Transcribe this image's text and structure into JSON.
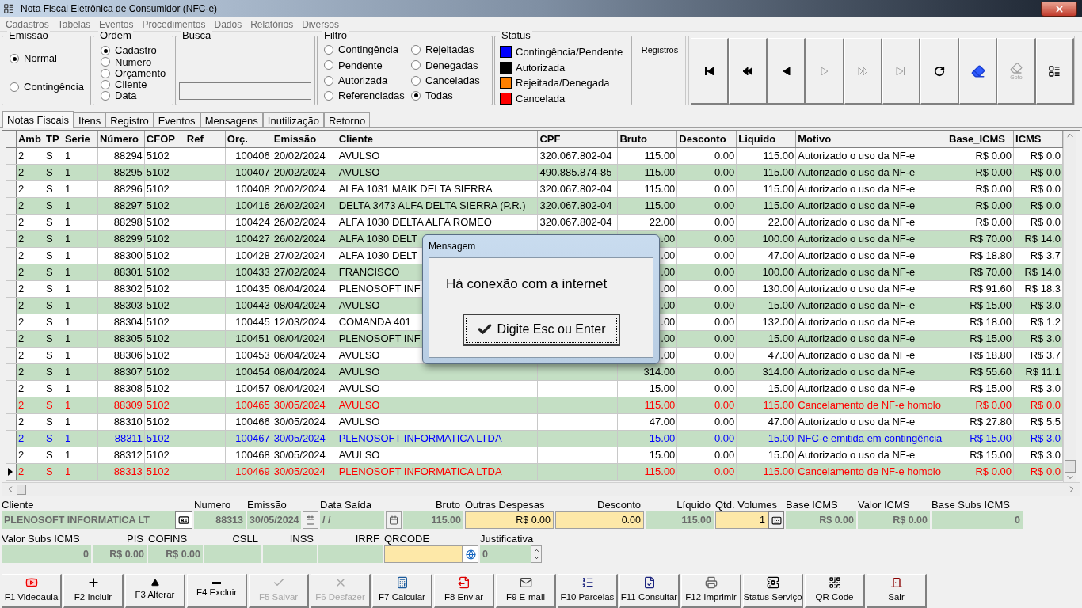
{
  "window": {
    "title": "Nota Fiscal Eletrônica de Consumidor (NFC-e)"
  },
  "menu": [
    "Cadastros",
    "Tabelas",
    "Eventos",
    "Procedimentos",
    "Dados",
    "Relatórios",
    "Diversos"
  ],
  "emissao": {
    "title": "Emissão",
    "options": [
      {
        "label": "Normal",
        "selected": true
      },
      {
        "label": "Contingência",
        "selected": false
      }
    ]
  },
  "ordem": {
    "title": "Ordem",
    "options": [
      {
        "label": "Cadastro",
        "selected": true
      },
      {
        "label": "Numero",
        "selected": false
      },
      {
        "label": "Orçamento",
        "selected": false
      },
      {
        "label": "Cliente",
        "selected": false
      },
      {
        "label": "Data",
        "selected": false
      }
    ]
  },
  "busca": {
    "title": "Busca"
  },
  "filtro": {
    "title": "Filtro",
    "options": [
      {
        "label": "Contingência",
        "selected": false
      },
      {
        "label": "Rejeitadas",
        "selected": false
      },
      {
        "label": "Pendente",
        "selected": false
      },
      {
        "label": "Denegadas",
        "selected": false
      },
      {
        "label": "Autorizada",
        "selected": false
      },
      {
        "label": "Canceladas",
        "selected": false
      },
      {
        "label": "Referenciadas",
        "selected": false
      },
      {
        "label": "Todas",
        "selected": true
      }
    ]
  },
  "status": {
    "title": "Status",
    "items": [
      {
        "label": "Contingência/Pendente",
        "color": "#0000ff"
      },
      {
        "label": "Autorizada",
        "color": "#000000"
      },
      {
        "label": "Rejeitada/Denegada",
        "color": "#ff8000"
      },
      {
        "label": "Cancelada",
        "color": "#ff0000"
      }
    ]
  },
  "registros": {
    "title": "Registros"
  },
  "nav_buttons": [
    {
      "kind": "first",
      "disabled": false
    },
    {
      "kind": "prior-page",
      "disabled": false
    },
    {
      "kind": "prior",
      "disabled": false
    },
    {
      "kind": "next",
      "disabled": true
    },
    {
      "kind": "next-page",
      "disabled": true
    },
    {
      "kind": "last",
      "disabled": true
    },
    {
      "kind": "refresh",
      "disabled": false
    },
    {
      "kind": "edit",
      "disabled": false
    },
    {
      "kind": "goto",
      "label": "Goto",
      "disabled": true
    },
    {
      "kind": "form",
      "disabled": false
    }
  ],
  "tabs": [
    {
      "label": "Notas Fiscais",
      "selected": true
    },
    {
      "label": "Itens",
      "selected": false
    },
    {
      "label": "Registro",
      "selected": false
    },
    {
      "label": "Eventos",
      "selected": false
    },
    {
      "label": "Mensagens",
      "selected": false
    },
    {
      "label": "Inutilização",
      "selected": false
    },
    {
      "label": "Retorno",
      "selected": false
    }
  ],
  "table": {
    "columns": [
      "Amb",
      "TP",
      "Serie",
      "Número",
      "CFOP",
      "Ref",
      "Orç.",
      "Emissão",
      "Cliente",
      "CPF",
      "Bruto",
      "Desconto",
      "Liquido",
      "Motivo",
      "Base_ICMS",
      "ICMS"
    ],
    "rows": [
      {
        "kind": "autorizada",
        "selected": false,
        "amb": "2",
        "tp": "S",
        "serie": "1",
        "numero": "88294",
        "cfop": "5102",
        "orc": "100406",
        "emissao": "20/02/2024",
        "cliente": "AVULSO",
        "cpf": "320.067.802-04",
        "bruto": "115.00",
        "desconto": "0.00",
        "liquido": "115.00",
        "motivo": "Autorizado o uso da NF-e",
        "base_icms": "R$ 0.00",
        "icms": "R$ 0.0"
      },
      {
        "kind": "autorizada",
        "selected": false,
        "amb": "2",
        "tp": "S",
        "serie": "1",
        "numero": "88295",
        "cfop": "5102",
        "orc": "100407",
        "emissao": "20/02/2024",
        "cliente": "AVULSO",
        "cpf": "490.885.874-85",
        "bruto": "115.00",
        "desconto": "0.00",
        "liquido": "115.00",
        "motivo": "Autorizado o uso da NF-e",
        "base_icms": "R$ 0.00",
        "icms": "R$ 0.0"
      },
      {
        "kind": "autorizada",
        "selected": false,
        "amb": "2",
        "tp": "S",
        "serie": "1",
        "numero": "88296",
        "cfop": "5102",
        "orc": "100408",
        "emissao": "20/02/2024",
        "cliente": "ALFA 1031 MAIK DELTA SIERRA",
        "cpf": "320.067.802-04",
        "bruto": "115.00",
        "desconto": "0.00",
        "liquido": "115.00",
        "motivo": "Autorizado o uso da NF-e",
        "base_icms": "R$ 0.00",
        "icms": "R$ 0.0"
      },
      {
        "kind": "autorizada",
        "selected": false,
        "amb": "2",
        "tp": "S",
        "serie": "1",
        "numero": "88297",
        "cfop": "5102",
        "orc": "100416",
        "emissao": "26/02/2024",
        "cliente": "DELTA 3473 ALFA DELTA SIERRA (P.R.)",
        "cpf": "320.067.802-04",
        "bruto": "115.00",
        "desconto": "0.00",
        "liquido": "115.00",
        "motivo": "Autorizado o uso da NF-e",
        "base_icms": "R$ 0.00",
        "icms": "R$ 0.0"
      },
      {
        "kind": "autorizada",
        "selected": false,
        "amb": "2",
        "tp": "S",
        "serie": "1",
        "numero": "88298",
        "cfop": "5102",
        "orc": "100424",
        "emissao": "26/02/2024",
        "cliente": "ALFA 1030 DELTA ALFA ROMEO",
        "cpf": "320.067.802-04",
        "bruto": "22.00",
        "desconto": "0.00",
        "liquido": "22.00",
        "motivo": "Autorizado o uso da NF-e",
        "base_icms": "R$ 0.00",
        "icms": "R$ 0.0"
      },
      {
        "kind": "autorizada",
        "selected": false,
        "amb": "2",
        "tp": "S",
        "serie": "1",
        "numero": "88299",
        "cfop": "5102",
        "orc": "100427",
        "emissao": "26/02/2024",
        "cliente": "ALFA 1030 DELT",
        "bruto": ".00",
        "desconto": "0.00",
        "liquido": "100.00",
        "motivo": "Autorizado o uso da NF-e",
        "base_icms": "R$ 70.00",
        "icms": "R$ 14.0"
      },
      {
        "kind": "autorizada",
        "selected": false,
        "amb": "2",
        "tp": "S",
        "serie": "1",
        "numero": "88300",
        "cfop": "5102",
        "orc": "100428",
        "emissao": "27/02/2024",
        "cliente": "ALFA 1030 DELT",
        "bruto": ".00",
        "desconto": "0.00",
        "liquido": "47.00",
        "motivo": "Autorizado o uso da NF-e",
        "base_icms": "R$ 18.80",
        "icms": "R$ 3.7"
      },
      {
        "kind": "autorizada",
        "selected": false,
        "amb": "2",
        "tp": "S",
        "serie": "1",
        "numero": "88301",
        "cfop": "5102",
        "orc": "100433",
        "emissao": "27/02/2024",
        "cliente": "FRANCISCO",
        "bruto": ".00",
        "desconto": "0.00",
        "liquido": "100.00",
        "motivo": "Autorizado o uso da NF-e",
        "base_icms": "R$ 70.00",
        "icms": "R$ 14.0"
      },
      {
        "kind": "autorizada",
        "selected": false,
        "amb": "2",
        "tp": "S",
        "serie": "1",
        "numero": "88302",
        "cfop": "5102",
        "orc": "100435",
        "emissao": "08/04/2024",
        "cliente": "PLENOSOFT INF",
        "bruto": ".00",
        "desconto": "0.00",
        "liquido": "130.00",
        "motivo": "Autorizado o uso da NF-e",
        "base_icms": "R$ 91.60",
        "icms": "R$ 18.3"
      },
      {
        "kind": "autorizada",
        "selected": false,
        "amb": "2",
        "tp": "S",
        "serie": "1",
        "numero": "88303",
        "cfop": "5102",
        "orc": "100443",
        "emissao": "08/04/2024",
        "cliente": "AVULSO",
        "bruto": ".00",
        "desconto": "0.00",
        "liquido": "15.00",
        "motivo": "Autorizado o uso da NF-e",
        "base_icms": "R$ 15.00",
        "icms": "R$ 3.0"
      },
      {
        "kind": "autorizada",
        "selected": false,
        "amb": "2",
        "tp": "S",
        "serie": "1",
        "numero": "88304",
        "cfop": "5102",
        "orc": "100445",
        "emissao": "12/03/2024",
        "cliente": "COMANDA 401",
        "bruto": ".00",
        "desconto": "0.00",
        "liquido": "132.00",
        "motivo": "Autorizado o uso da NF-e",
        "base_icms": "R$ 18.00",
        "icms": "R$ 1.2"
      },
      {
        "kind": "autorizada",
        "selected": false,
        "amb": "2",
        "tp": "S",
        "serie": "1",
        "numero": "88305",
        "cfop": "5102",
        "orc": "100451",
        "emissao": "08/04/2024",
        "cliente": "PLENOSOFT INF",
        "bruto": ".00",
        "desconto": "0.00",
        "liquido": "15.00",
        "motivo": "Autorizado o uso da NF-e",
        "base_icms": "R$ 15.00",
        "icms": "R$ 3.0"
      },
      {
        "kind": "autorizada",
        "selected": false,
        "amb": "2",
        "tp": "S",
        "serie": "1",
        "numero": "88306",
        "cfop": "5102",
        "orc": "100453",
        "emissao": "06/04/2024",
        "cliente": "AVULSO",
        "bruto": ".00",
        "desconto": "0.00",
        "liquido": "47.00",
        "motivo": "Autorizado o uso da NF-e",
        "base_icms": "R$ 18.80",
        "icms": "R$ 3.7"
      },
      {
        "kind": "autorizada",
        "selected": false,
        "amb": "2",
        "tp": "S",
        "serie": "1",
        "numero": "88307",
        "cfop": "5102",
        "orc": "100454",
        "emissao": "08/04/2024",
        "cliente": "AVULSO",
        "bruto": "314.00",
        "desconto": "0.00",
        "liquido": "314.00",
        "motivo": "Autorizado o uso da NF-e",
        "base_icms": "R$ 55.60",
        "icms": "R$ 11.1"
      },
      {
        "kind": "autorizada",
        "selected": false,
        "amb": "2",
        "tp": "S",
        "serie": "1",
        "numero": "88308",
        "cfop": "5102",
        "orc": "100457",
        "emissao": "08/04/2024",
        "cliente": "AVULSO",
        "bruto": "15.00",
        "desconto": "0.00",
        "liquido": "15.00",
        "motivo": "Autorizado o uso da NF-e",
        "base_icms": "R$ 15.00",
        "icms": "R$ 3.0"
      },
      {
        "kind": "cancelada",
        "selected": false,
        "amb": "2",
        "tp": "S",
        "serie": "1",
        "numero": "88309",
        "cfop": "5102",
        "orc": "100465",
        "emissao": "30/05/2024",
        "cliente": "AVULSO",
        "bruto": "115.00",
        "desconto": "0.00",
        "liquido": "115.00",
        "motivo": "Cancelamento de NF-e homolo",
        "base_icms": "R$ 0.00",
        "icms": "R$ 0.0"
      },
      {
        "kind": "autorizada",
        "selected": false,
        "amb": "2",
        "tp": "S",
        "serie": "1",
        "numero": "88310",
        "cfop": "5102",
        "orc": "100466",
        "emissao": "30/05/2024",
        "cliente": "AVULSO",
        "bruto": "47.00",
        "desconto": "0.00",
        "liquido": "47.00",
        "motivo": "Autorizado o uso da NF-e",
        "base_icms": "R$ 27.80",
        "icms": "R$ 5.5"
      },
      {
        "kind": "contingencia",
        "selected": false,
        "amb": "2",
        "tp": "S",
        "serie": "1",
        "numero": "88311",
        "cfop": "5102",
        "orc": "100467",
        "emissao": "30/05/2024",
        "cliente": "PLENOSOFT INFORMATICA LTDA",
        "bruto": "15.00",
        "desconto": "0.00",
        "liquido": "15.00",
        "motivo": "NFC-e emitida em contingência",
        "base_icms": "R$ 15.00",
        "icms": "R$ 3.0"
      },
      {
        "kind": "autorizada",
        "selected": false,
        "amb": "2",
        "tp": "S",
        "serie": "1",
        "numero": "88312",
        "cfop": "5102",
        "orc": "100468",
        "emissao": "30/05/2024",
        "cliente": "AVULSO",
        "bruto": "15.00",
        "desconto": "0.00",
        "liquido": "15.00",
        "motivo": "Autorizado o uso da NF-e",
        "base_icms": "R$ 15.00",
        "icms": "R$ 3.0"
      },
      {
        "kind": "cancelada",
        "selected": true,
        "amb": "2",
        "tp": "S",
        "serie": "1",
        "numero": "88313",
        "cfop": "5102",
        "orc": "100469",
        "emissao": "30/05/2024",
        "cliente": "PLENOSOFT INFORMATICA LTDA",
        "bruto": "115.00",
        "desconto": "0.00",
        "liquido": "115.00",
        "motivo": "Cancelamento de NF-e homolo",
        "base_icms": "R$ 0.00",
        "icms": "R$ 0.0"
      }
    ]
  },
  "dialog": {
    "title": "Mensagem",
    "message": "Há conexão com a internet",
    "button": "Digite Esc ou Enter"
  },
  "fields_row1": [
    {
      "label": "Cliente",
      "value": "PLENOSOFT INFORMATICA LT",
      "editable": false
    },
    {
      "label": "Numero",
      "value": "88313",
      "editable": false
    },
    {
      "label": "Emissão",
      "value": "30/05/2024",
      "editable": false
    },
    {
      "label": "Data Saída",
      "value": "/ /",
      "editable": false
    },
    {
      "label": "Bruto",
      "value": "115.00",
      "editable": false
    },
    {
      "label": "Outras Despesas",
      "value": "R$ 0.00",
      "editable": true
    },
    {
      "label": "Desconto",
      "value": "0.00",
      "editable": true
    },
    {
      "label": "Líquido",
      "value": "115.00",
      "editable": false
    },
    {
      "label": "Qtd. Volumes",
      "value": "1",
      "editable": true
    },
    {
      "label": "Base ICMS",
      "value": "R$ 0.00",
      "editable": false
    },
    {
      "label": "Valor ICMS",
      "value": "R$ 0.00",
      "editable": false
    },
    {
      "label": "Base Subs ICMS",
      "value": "0",
      "editable": false
    }
  ],
  "fields_row2": [
    {
      "label": "Valor Subs ICMS",
      "value": "0",
      "editable": false
    },
    {
      "label": "PIS",
      "value": "R$ 0.00",
      "editable": false
    },
    {
      "label": "COFINS",
      "value": "R$ 0.00",
      "editable": false
    },
    {
      "label": "CSLL",
      "editable": false
    },
    {
      "label": "INSS",
      "editable": false
    },
    {
      "label": "IRRF",
      "editable": false
    },
    {
      "label": "QRCODE",
      "editable": true
    },
    {
      "label": "Justificativa",
      "value": "0",
      "editable": false
    }
  ],
  "buttons": [
    {
      "kind": "video",
      "label": "F1 Videoaula",
      "disabled": false
    },
    {
      "kind": "add",
      "label": "F2 Incluir",
      "disabled": false
    },
    {
      "kind": "edit",
      "label": "F3 Alterar",
      "disabled": false
    },
    {
      "kind": "delete",
      "label": "F4 Excluir",
      "disabled": false
    },
    {
      "kind": "save",
      "label": "F5 Salvar",
      "disabled": true
    },
    {
      "kind": "undo",
      "label": "F6 Desfazer",
      "disabled": true
    },
    {
      "kind": "calc",
      "label": "F7 Calcular",
      "disabled": false
    },
    {
      "kind": "send",
      "label": "F8 Enviar",
      "disabled": false
    },
    {
      "kind": "mail",
      "label": "F9 E-mail",
      "disabled": false
    },
    {
      "kind": "list",
      "label": "F10 Parcelas",
      "disabled": false
    },
    {
      "kind": "check",
      "label": "F11 Consultar",
      "disabled": false
    },
    {
      "kind": "print",
      "label": "F12 Imprimir",
      "disabled": false
    },
    {
      "kind": "service",
      "label": "Status Serviço",
      "disabled": false
    },
    {
      "kind": "qr",
      "label": "QR Code",
      "disabled": false
    },
    {
      "kind": "exit",
      "label": "Sair",
      "disabled": false
    }
  ]
}
